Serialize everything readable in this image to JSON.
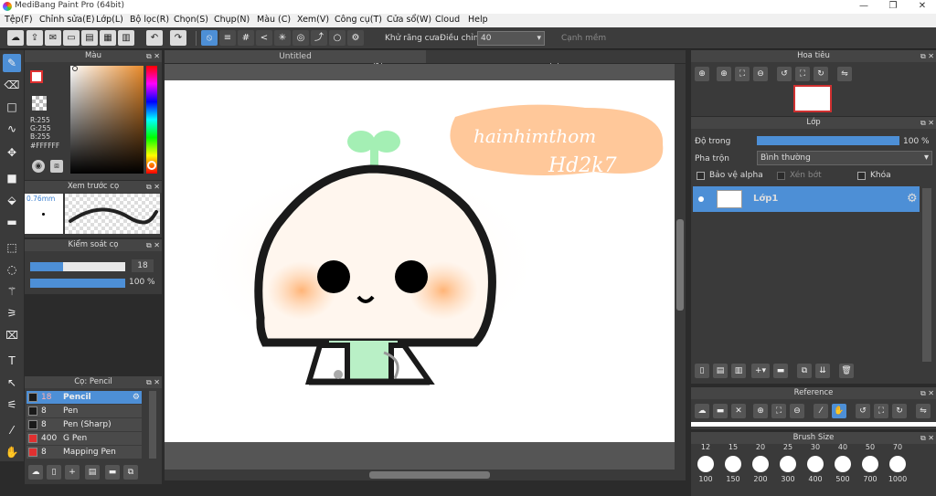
{
  "window": {
    "title": "MediBang Paint Pro (64bit)",
    "minimize": "—",
    "restore": "❐",
    "close": "✕"
  },
  "menu": [
    "Tệp(F)",
    "Chỉnh sửa(E)",
    "Lớp(L)",
    "Bộ lọc(R)",
    "Chọn(S)",
    "Chụp(N)",
    "Màu (C)",
    "Xem(V)",
    "Công cụ(T)",
    "Cửa sổ(W)",
    "Cloud",
    "Help"
  ],
  "toolbar": {
    "antialias_label": "Khử răng cưa",
    "antialias_checked": true,
    "correction_label": "Điều chỉnh",
    "correction_value": "40",
    "smooth_label": "Cạnh mềm",
    "smooth_checked": false
  },
  "canvas": {
    "tab_title": "Untitled"
  },
  "color_panel": {
    "title": "Màu",
    "r": "R:255",
    "g": "G:255",
    "b": "B:255",
    "hex": "#FFFFFF",
    "fg_color": "#ffffff",
    "bg_color": "#e83030"
  },
  "brush_preview": {
    "title": "Xem trước cọ",
    "size": "0.76mm"
  },
  "brush_control": {
    "title": "Kiểm soát cọ",
    "size_value": "18",
    "size_fraction": 0.35,
    "opacity_value": "100 %",
    "opacity_fraction": 1.0
  },
  "brush_list": {
    "title": "Cọ: Pencil",
    "items": [
      {
        "size": "18",
        "name": "Pencil",
        "color": "#1a1a1a",
        "selected": true
      },
      {
        "size": "8",
        "name": "Pen",
        "color": "#1a1a1a",
        "selected": false
      },
      {
        "size": "8",
        "name": "Pen (Sharp)",
        "color": "#1a1a1a",
        "selected": false
      },
      {
        "size": "400",
        "name": "G Pen",
        "color": "#e03030",
        "selected": false
      },
      {
        "size": "8",
        "name": "Mapping Pen",
        "color": "#e03030",
        "selected": false
      }
    ]
  },
  "navigator": {
    "title": "Hoa tiêu"
  },
  "layers": {
    "title": "Lớp",
    "opacity_label": "Độ trong",
    "opacity_value": "100 %",
    "opacity_fraction": 1.0,
    "blend_label": "Pha trộn",
    "blend_value": "Bình thường",
    "protect_alpha": "Bảo vệ alpha",
    "clipping": "Xén bớt",
    "lock": "Khóa",
    "items": [
      {
        "name": "Lớp1",
        "selected": true
      }
    ]
  },
  "reference": {
    "title": "Reference"
  },
  "brush_size": {
    "title": "Brush Size",
    "top": [
      "12",
      "15",
      "20",
      "25",
      "30",
      "40",
      "50",
      "70"
    ],
    "bottom": [
      "100",
      "150",
      "200",
      "300",
      "400",
      "500",
      "700",
      "1000"
    ]
  },
  "artwork_text": {
    "line1": "hainhimthom",
    "line2": "Hd2k7"
  }
}
